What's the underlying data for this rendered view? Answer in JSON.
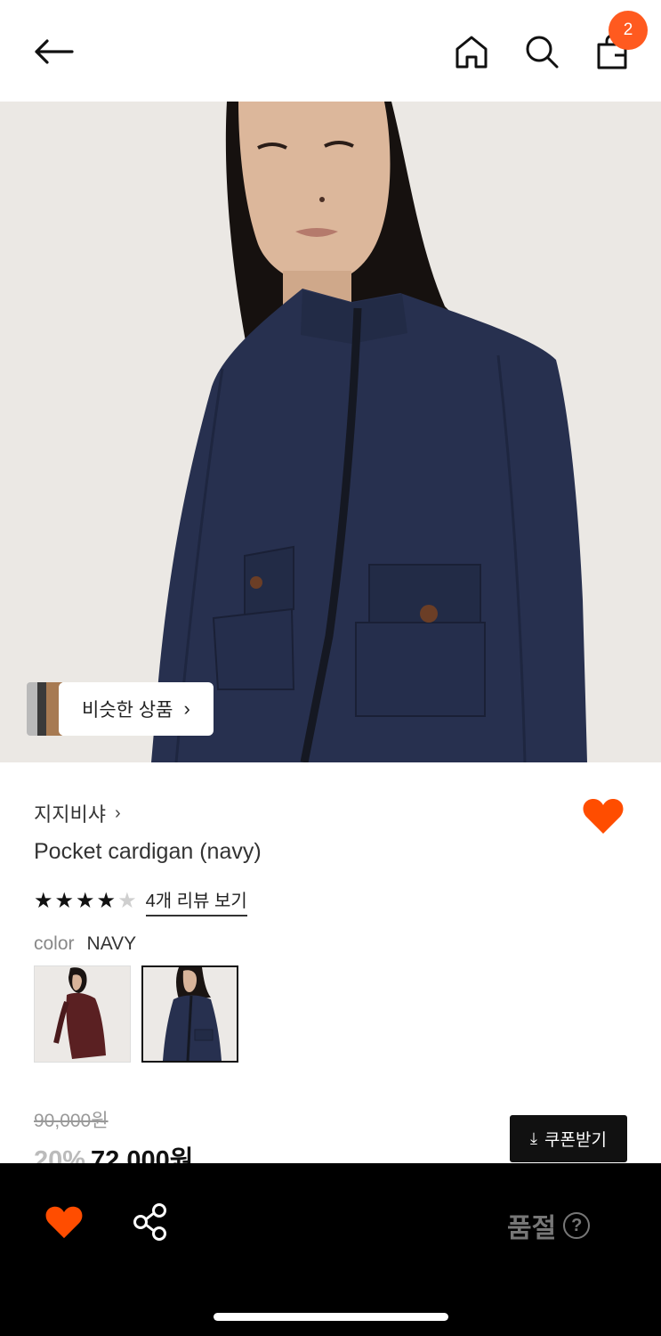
{
  "header": {
    "back_icon": "arrow-left-icon",
    "home_icon": "home-icon",
    "search_icon": "search-icon",
    "bag_icon": "shopping-bag-icon",
    "bag_count": "2",
    "badge_color": "#ff5a1f"
  },
  "hero": {
    "similar_label": "비슷한 상품",
    "similar_chevron": "›"
  },
  "product": {
    "brand": "지지비샤",
    "brand_chevron": "›",
    "title": "Pocket cardigan (navy)",
    "rating": 4,
    "rating_max": 5,
    "review_link": "4개 리뷰 보기",
    "color_label": "color",
    "color_value": "NAVY",
    "swatches": [
      "burgundy",
      "navy"
    ],
    "selected_swatch": "navy",
    "favorite_color": "#ff4d00"
  },
  "pricing": {
    "original_price": "90,000원",
    "discount": "20%",
    "sale_price": "72,000원",
    "coupon_label": "쿠폰받기",
    "coupon_icon": "download-icon"
  },
  "bottom_bar": {
    "heart_icon": "heart-icon",
    "share_icon": "share-icon",
    "status": "품절",
    "help_glyph": "?"
  }
}
